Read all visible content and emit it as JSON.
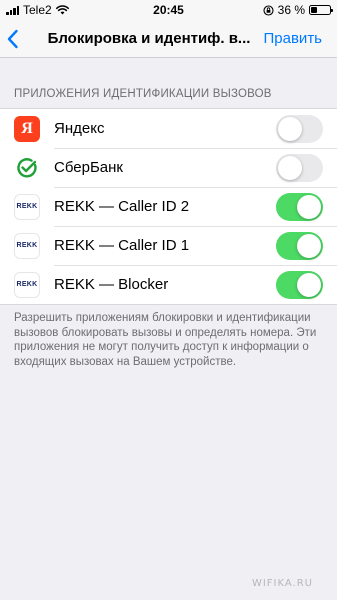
{
  "status_bar": {
    "carrier": "Tele2",
    "time": "20:45",
    "battery_text": "36 %",
    "battery_level": 0.36,
    "icons": [
      "signal-icon",
      "wifi-icon",
      "rotation-lock-icon",
      "battery-icon"
    ]
  },
  "nav": {
    "back_icon": "chevron-left-icon",
    "title": "Блокировка и идентиф. в...",
    "edit_label": "Править",
    "accent_color": "#007aff"
  },
  "section": {
    "header": "ПРИЛОЖЕНИЯ ИДЕНТИФИКАЦИИ ВЫЗОВОВ",
    "rows": [
      {
        "icon_text": "Я",
        "label": "Яндекс",
        "toggle": "off",
        "icon": "yandex-app-icon"
      },
      {
        "icon_text": "",
        "label": "СберБанк",
        "toggle": "off",
        "icon": "sberbank-app-icon"
      },
      {
        "icon_text": "REKK",
        "label": "REKK — Caller ID 2",
        "toggle": "on",
        "icon": "rekk-app-icon"
      },
      {
        "icon_text": "REKK",
        "label": "REKK — Caller ID 1",
        "toggle": "on",
        "icon": "rekk-app-icon"
      },
      {
        "icon_text": "REKK",
        "label": "REKK — Blocker",
        "toggle": "on",
        "icon": "rekk-app-icon"
      }
    ],
    "footer": "Разрешить приложениям блокировки и идентификации вызовов блокировать вызовы и определять номера. Эти приложения не могут получить доступ к информации о входящих вызовах на Вашем устройстве.",
    "toggle_on_color": "#4cd964"
  },
  "watermark": "WIFIKA.RU"
}
